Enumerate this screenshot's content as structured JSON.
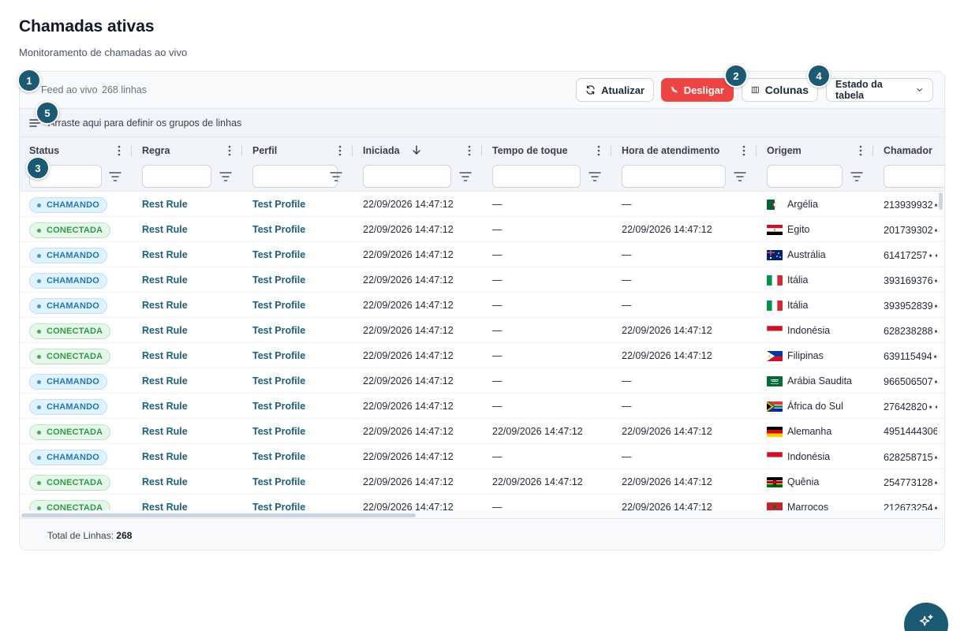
{
  "page": {
    "title": "Chamadas ativas",
    "subtitle": "Monitoramento de chamadas ao vivo"
  },
  "toolbar": {
    "feed_label": "Feed ao vivo",
    "rows_label": "268 linhas",
    "refresh_label": "Atualizar",
    "hangup_label": "Desligar",
    "columns_label": "Colunas",
    "table_state_label": "Estado da tabela"
  },
  "group_bar": {
    "text": "Arraste aqui para definir os grupos de linhas"
  },
  "columns": [
    {
      "label": "Status"
    },
    {
      "label": "Regra"
    },
    {
      "label": "Perfil"
    },
    {
      "label": "Iniciada"
    },
    {
      "label": "Tempo de toque"
    },
    {
      "label": "Hora de atendimento"
    },
    {
      "label": "Origem"
    },
    {
      "label": "Chamador"
    }
  ],
  "rows": [
    {
      "status": "CHAMANDO",
      "rule": "Rest Rule",
      "profile": "Test Profile",
      "started": "22/09/2026 14:47:12",
      "ring_time": "—",
      "answer_time": "—",
      "origin": "Argélia",
      "flag": "dz",
      "caller": "213939932⋆"
    },
    {
      "status": "CONECTADA",
      "rule": "Rest Rule",
      "profile": "Test Profile",
      "started": "22/09/2026 14:47:12",
      "ring_time": "—",
      "answer_time": "22/09/2026 14:47:12",
      "origin": "Egito",
      "flag": "eg",
      "caller": "201739302⋆"
    },
    {
      "status": "CHAMANDO",
      "rule": "Rest Rule",
      "profile": "Test Profile",
      "started": "22/09/2026 14:47:12",
      "ring_time": "—",
      "answer_time": "—",
      "origin": "Austrália",
      "flag": "au",
      "caller": "61417257⋆⋆"
    },
    {
      "status": "CHAMANDO",
      "rule": "Rest Rule",
      "profile": "Test Profile",
      "started": "22/09/2026 14:47:12",
      "ring_time": "—",
      "answer_time": "—",
      "origin": "Itália",
      "flag": "it",
      "caller": "393169376⋆"
    },
    {
      "status": "CHAMANDO",
      "rule": "Rest Rule",
      "profile": "Test Profile",
      "started": "22/09/2026 14:47:12",
      "ring_time": "—",
      "answer_time": "—",
      "origin": "Itália",
      "flag": "it",
      "caller": "393952839⋆"
    },
    {
      "status": "CONECTADA",
      "rule": "Rest Rule",
      "profile": "Test Profile",
      "started": "22/09/2026 14:47:12",
      "ring_time": "—",
      "answer_time": "22/09/2026 14:47:12",
      "origin": "Indonésia",
      "flag": "id",
      "caller": "628238288⋆"
    },
    {
      "status": "CONECTADA",
      "rule": "Rest Rule",
      "profile": "Test Profile",
      "started": "22/09/2026 14:47:12",
      "ring_time": "—",
      "answer_time": "22/09/2026 14:47:12",
      "origin": "Filipinas",
      "flag": "ph",
      "caller": "639115494⋆"
    },
    {
      "status": "CHAMANDO",
      "rule": "Rest Rule",
      "profile": "Test Profile",
      "started": "22/09/2026 14:47:12",
      "ring_time": "—",
      "answer_time": "—",
      "origin": "Arábia Saudita",
      "flag": "sa",
      "caller": "966506507⋆"
    },
    {
      "status": "CHAMANDO",
      "rule": "Rest Rule",
      "profile": "Test Profile",
      "started": "22/09/2026 14:47:12",
      "ring_time": "—",
      "answer_time": "—",
      "origin": "África do Sul",
      "flag": "za",
      "caller": "27642820⋆⋆"
    },
    {
      "status": "CONECTADA",
      "rule": "Rest Rule",
      "profile": "Test Profile",
      "started": "22/09/2026 14:47:12",
      "ring_time": "22/09/2026 14:47:12",
      "answer_time": "22/09/2026 14:47:12",
      "origin": "Alemanha",
      "flag": "de",
      "caller": "4951444306"
    },
    {
      "status": "CHAMANDO",
      "rule": "Rest Rule",
      "profile": "Test Profile",
      "started": "22/09/2026 14:47:12",
      "ring_time": "—",
      "answer_time": "—",
      "origin": "Indonésia",
      "flag": "id",
      "caller": "628258715⋆"
    },
    {
      "status": "CONECTADA",
      "rule": "Rest Rule",
      "profile": "Test Profile",
      "started": "22/09/2026 14:47:12",
      "ring_time": "22/09/2026 14:47:12",
      "answer_time": "22/09/2026 14:47:12",
      "origin": "Quênia",
      "flag": "ke",
      "caller": "254773128⋆"
    },
    {
      "status": "CONECTADA",
      "rule": "Rest Rule",
      "profile": "Test Profile",
      "started": "22/09/2026 14:47:12",
      "ring_time": "—",
      "answer_time": "22/09/2026 14:47:12",
      "origin": "Marrocos",
      "flag": "ma",
      "caller": "212673254⋆"
    }
  ],
  "footer": {
    "total_label": "Total de Linhas:",
    "total_value": "268"
  },
  "markers": [
    "1",
    "2",
    "3",
    "4",
    "5"
  ],
  "colors": {
    "accent": "#1b5a72",
    "danger": "#ef4444",
    "link": "#1d5f7a",
    "calling": "#1e7ab0",
    "connected": "#2e9a4a"
  }
}
